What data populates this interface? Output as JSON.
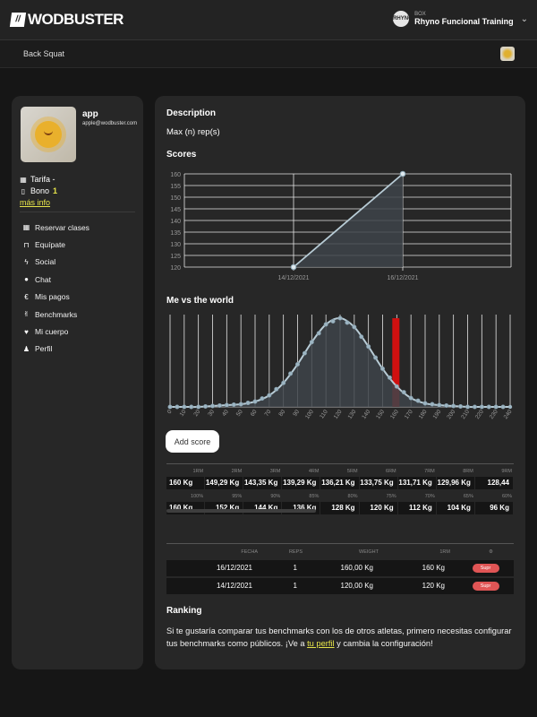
{
  "header": {
    "brand": "WODBUSTER",
    "box_label": "BOX",
    "box_logo_text": "RHYNO",
    "box_name": "Rhyno Funcional Training",
    "chevron_icon": "chevron-down-icon"
  },
  "subheader": {
    "title": "Back Squat"
  },
  "profile": {
    "name": "app",
    "email": "apple@wodbuster.com",
    "tarifa_label": "Tarifa -",
    "bono_label": "Bono",
    "bono_value": "1",
    "more_info": "más info"
  },
  "menu": [
    {
      "label": "Reservar clases",
      "icon": "calendar-icon"
    },
    {
      "label": "Equípate",
      "icon": "bag-icon"
    },
    {
      "label": "Social",
      "icon": "bolt-icon"
    },
    {
      "label": "Chat",
      "icon": "chat-icon"
    },
    {
      "label": "Mis pagos",
      "icon": "euro-icon"
    },
    {
      "label": "Benchmarks",
      "icon": "victory-hand-icon"
    },
    {
      "label": "Mi cuerpo",
      "icon": "heartbeat-icon"
    },
    {
      "label": "Perfil",
      "icon": "user-icon"
    }
  ],
  "main": {
    "description_title": "Description",
    "description_text": "Max (n) rep(s)",
    "scores_title": "Scores",
    "world_title": "Me vs the world",
    "add_score": "Add score",
    "ranking_title": "Ranking",
    "ranking_text_1": "Si te gustaría comparar tus benchmarks con los de otros atletas, primero necesitas configurar tus benchmarks como públicos. ¡Ve a ",
    "ranking_link": "tu perfil",
    "ranking_text_2": " y cambia la configuración!"
  },
  "rm_table": {
    "headers": [
      "1RM",
      "2RM",
      "3RM",
      "4RM",
      "5RM",
      "6RM",
      "7RM",
      "8RM",
      "9RM"
    ],
    "values": [
      "160 Kg",
      "149,29 Kg",
      "143,35 Kg",
      "139,29 Kg",
      "136,21 Kg",
      "133,75 Kg",
      "131,71 Kg",
      "129,96 Kg",
      "128,44"
    ],
    "pct_headers": [
      "100%",
      "95%",
      "90%",
      "85%",
      "80%",
      "75%",
      "70%",
      "65%",
      "60%"
    ],
    "pct_values": [
      "160 Kg",
      "152 Kg",
      "144 Kg",
      "136 Kg",
      "128 Kg",
      "120 Kg",
      "112 Kg",
      "104 Kg",
      "96 Kg"
    ]
  },
  "history": {
    "headers": [
      "FECHA",
      "REPS",
      "WEIGHT",
      "1RM",
      "⚙"
    ],
    "rows": [
      {
        "fecha": "16/12/2021",
        "reps": "1",
        "weight": "160,00 Kg",
        "rm": "160 Kg",
        "action": "Supr"
      },
      {
        "fecha": "14/12/2021",
        "reps": "1",
        "weight": "120,00 Kg",
        "rm": "120 Kg",
        "action": "Supr"
      }
    ]
  },
  "chart_data": [
    {
      "type": "area",
      "title": "Scores",
      "categories": [
        "14/12/2021",
        "16/12/2021"
      ],
      "values": [
        120,
        160
      ],
      "ylim": [
        120,
        160
      ],
      "yticks": [
        120,
        125,
        130,
        135,
        140,
        145,
        150,
        155,
        160
      ],
      "grid": true
    },
    {
      "type": "area",
      "title": "Me vs the world",
      "x": [
        0,
        10,
        20,
        30,
        40,
        50,
        60,
        70,
        80,
        90,
        100,
        110,
        120,
        130,
        140,
        150,
        160,
        170,
        180,
        190,
        200,
        210,
        220,
        230,
        240
      ],
      "y_rel": [
        0.0,
        0.0,
        0.0,
        0.01,
        0.02,
        0.03,
        0.06,
        0.13,
        0.27,
        0.48,
        0.73,
        0.93,
        1.0,
        0.9,
        0.68,
        0.43,
        0.23,
        0.1,
        0.04,
        0.02,
        0.01,
        0.0,
        0.0,
        0.0,
        0.0
      ],
      "highlight_x": 160,
      "highlight_color": "#d01010",
      "grid": true
    }
  ],
  "colors": {
    "accent": "#e6e44a",
    "danger": "#e05555",
    "line": "#b8ccd6"
  }
}
